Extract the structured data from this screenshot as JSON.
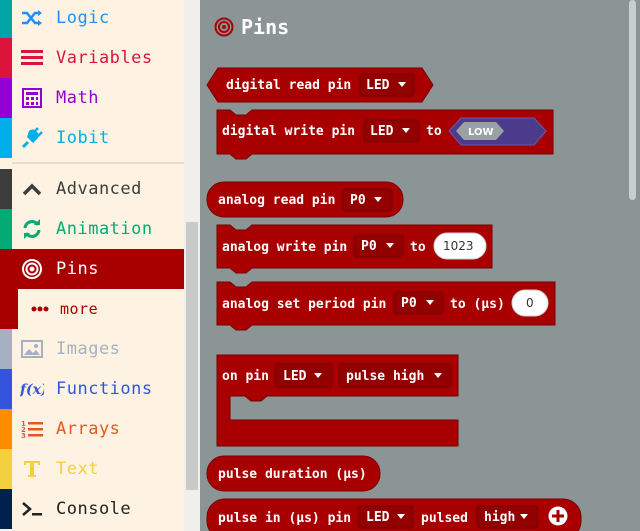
{
  "toolbox": {
    "categories": [
      {
        "label": "Logic",
        "color": "#00a4a6",
        "icon": "shuffle-icon"
      },
      {
        "label": "Variables",
        "color": "#dc143c",
        "icon": "list-lines-icon"
      },
      {
        "label": "Math",
        "color": "#9400d3",
        "icon": "calculator-icon"
      },
      {
        "label": "Iobit",
        "color": "#00aeea",
        "icon": "plug-icon"
      },
      {
        "label": "Advanced",
        "color": "#3c3c3c",
        "icon": "chevron-up-icon"
      },
      {
        "label": "Animation",
        "color": "#03aa74",
        "icon": "refresh-icon"
      },
      {
        "label": "Pins",
        "color": "#a80000",
        "icon": "target-icon"
      },
      {
        "label": "more",
        "color": "#a80000",
        "icon": "dots-icon"
      },
      {
        "label": "Images",
        "color": "#a5b1c2",
        "icon": "image-icon"
      },
      {
        "label": "Functions",
        "color": "#3455db",
        "icon": "fx-icon"
      },
      {
        "label": "Arrays",
        "color": "#e65722",
        "icon": "numbered-list-icon"
      },
      {
        "label": "Text",
        "color": "#f4d03f",
        "icon": "text-t-icon"
      },
      {
        "label": "Console",
        "color": "#002050",
        "icon": "terminal-icon"
      }
    ]
  },
  "flyout": {
    "title": "Pins",
    "accent": "#a80000",
    "blocks": {
      "digital_read": {
        "label": "digital read pin",
        "pin": "LED"
      },
      "digital_write": {
        "label": "digital write pin",
        "pin": "LED",
        "to": "to",
        "value": "LOW"
      },
      "analog_read": {
        "label": "analog read pin",
        "pin": "P0"
      },
      "analog_write": {
        "label": "analog write pin",
        "pin": "P0",
        "to": "to",
        "value": "1023"
      },
      "analog_period": {
        "label": "analog set period pin",
        "pin": "P0",
        "to": "to (µs)",
        "value": "0"
      },
      "on_pin": {
        "label": "on pin",
        "pin": "LED",
        "pulse": "pulse high"
      },
      "pulse_duration": {
        "label": "pulse duration (µs)"
      },
      "pulse_in": {
        "label": "pulse in (µs) pin",
        "pin": "LED",
        "pulsed": "pulsed",
        "value": "high"
      }
    }
  }
}
